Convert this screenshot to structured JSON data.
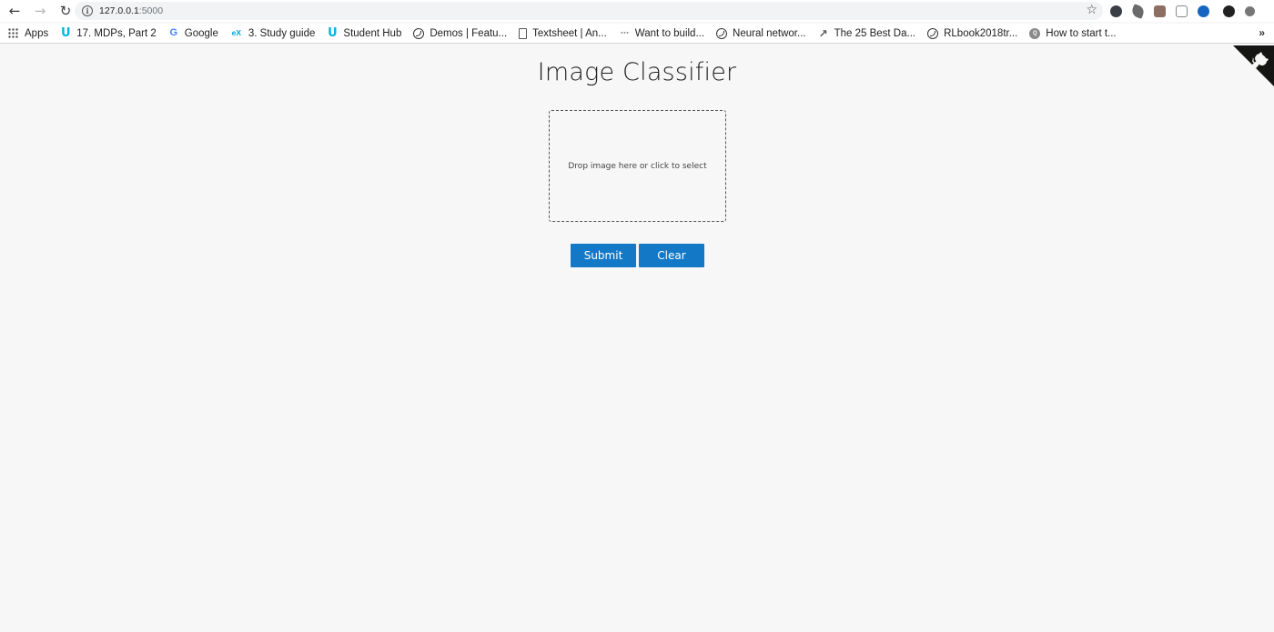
{
  "browser": {
    "url_host": "127.0.0.1",
    "url_port": ":5000",
    "bookmarks": [
      {
        "label": "Apps",
        "icon": "apps-grid-icon"
      },
      {
        "label": "17. MDPs, Part 2",
        "icon": "udacity-icon"
      },
      {
        "label": "Google",
        "icon": "google-icon"
      },
      {
        "label": "3. Study guide",
        "icon": "edx-icon"
      },
      {
        "label": "Student Hub",
        "icon": "udacity-icon"
      },
      {
        "label": "Demos | Featu...",
        "icon": "globe-icon"
      },
      {
        "label": "Textsheet | An...",
        "icon": "document-icon"
      },
      {
        "label": "Want to build...",
        "icon": "dots-icon"
      },
      {
        "label": "Neural networ...",
        "icon": "globe-icon"
      },
      {
        "label": "The 25 Best Da...",
        "icon": "chart-icon"
      },
      {
        "label": "RLbook2018tr...",
        "icon": "globe-icon"
      },
      {
        "label": "How to start t...",
        "icon": "quora-icon"
      }
    ],
    "more_bookmarks": "»"
  },
  "page": {
    "title": "Image Classifier",
    "dropzone_text": "Drop image here or click to select",
    "submit_label": "Submit",
    "clear_label": "Clear"
  },
  "colors": {
    "page_background": "#f7f7f7",
    "button_blue": "#1379c6"
  }
}
